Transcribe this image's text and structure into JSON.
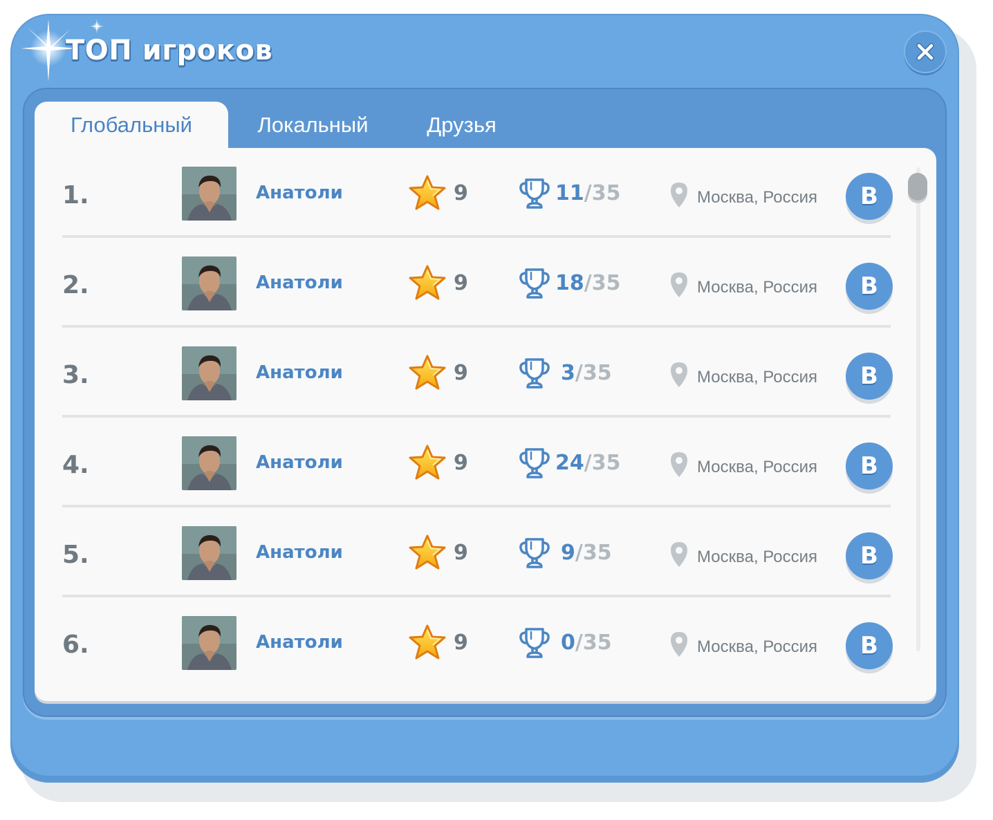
{
  "window": {
    "title": "ТОП игроков"
  },
  "tabs": [
    {
      "label": "Глобальный",
      "active": true
    },
    {
      "label": "Локальный",
      "active": false
    },
    {
      "label": "Друзья",
      "active": false
    }
  ],
  "players": [
    {
      "rank": "1.",
      "name": "Анатоли",
      "stars": "9",
      "cups_won": "11",
      "cups_total": "/35",
      "location": "Москва, Россия",
      "social": "В"
    },
    {
      "rank": "2.",
      "name": "Анатоли",
      "stars": "9",
      "cups_won": "18",
      "cups_total": "/35",
      "location": "Москва, Россия",
      "social": "В"
    },
    {
      "rank": "3.",
      "name": "Анатоли",
      "stars": "9",
      "cups_won": "3",
      "cups_total": "/35",
      "location": "Москва, Россия",
      "social": "В"
    },
    {
      "rank": "4.",
      "name": "Анатоли",
      "stars": "9",
      "cups_won": "24",
      "cups_total": "/35",
      "location": "Москва, Россия",
      "social": "В"
    },
    {
      "rank": "5.",
      "name": "Анатоли",
      "stars": "9",
      "cups_won": "9",
      "cups_total": "/35",
      "location": "Москва, Россия",
      "social": "В"
    },
    {
      "rank": "6.",
      "name": "Анатоли",
      "stars": "9",
      "cups_won": "0",
      "cups_total": "/35",
      "location": "Москва, Россия",
      "social": "В"
    }
  ],
  "icons": {
    "close": "close-icon",
    "star": "star-icon",
    "trophy": "trophy-icon",
    "location": "location-pin-icon",
    "social": "vk-icon",
    "avatar": "avatar-photo"
  },
  "colors": {
    "window": "#6aa8e3",
    "accent": "#4b86c4",
    "muted": "#b1b9bf",
    "panel": "#f9f9f9"
  }
}
